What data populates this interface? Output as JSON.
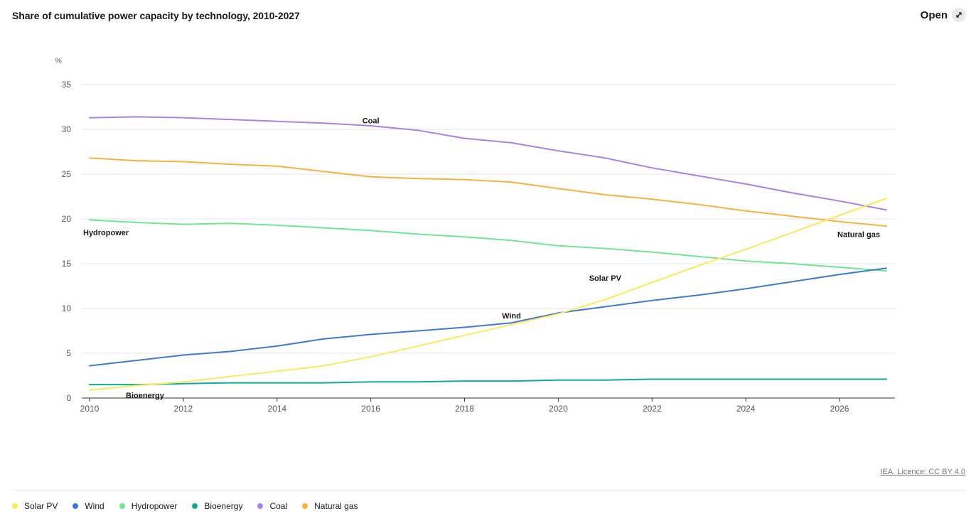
{
  "title": "Share of cumulative power capacity by technology, 2010-2027",
  "open_button": {
    "label": "Open",
    "icon": "expand-arrows-icon"
  },
  "licence": "IEA. Licence: CC BY 4.0",
  "chart_data": {
    "type": "line",
    "title": "Share of cumulative power capacity by technology, 2010-2027",
    "ylabel": "%",
    "xlabel": "",
    "x": [
      2010,
      2011,
      2012,
      2013,
      2014,
      2015,
      2016,
      2017,
      2018,
      2019,
      2020,
      2021,
      2022,
      2023,
      2024,
      2025,
      2026,
      2027
    ],
    "xticks": [
      2010,
      2012,
      2014,
      2016,
      2018,
      2020,
      2022,
      2024,
      2026
    ],
    "yticks": [
      0,
      5,
      10,
      15,
      20,
      25,
      30,
      35
    ],
    "ylim": [
      0,
      35
    ],
    "xlim": [
      2010,
      2027
    ],
    "grid": "horizontal",
    "legend_position": "bottom-left",
    "series": [
      {
        "name": "Solar PV",
        "color": "#fbe95f",
        "label_year": 2021,
        "label_value": 13.4,
        "values": [
          0.9,
          1.4,
          1.8,
          2.4,
          3.0,
          3.6,
          4.6,
          5.8,
          7.0,
          8.2,
          9.4,
          11.0,
          12.9,
          14.8,
          16.6,
          18.5,
          20.4,
          22.3
        ]
      },
      {
        "name": "Wind",
        "color": "#3e7ad3",
        "label_year": 2019,
        "label_value": 9.2,
        "values": [
          3.6,
          4.2,
          4.8,
          5.2,
          5.8,
          6.6,
          7.1,
          7.5,
          7.9,
          8.4,
          9.5,
          10.2,
          10.9,
          11.5,
          12.2,
          13.0,
          13.8,
          14.5
        ]
      },
      {
        "name": "Hydropower",
        "color": "#71e58f",
        "label_year": 2010,
        "label_value": 18.5,
        "values": [
          19.9,
          19.6,
          19.4,
          19.5,
          19.3,
          19.0,
          18.7,
          18.3,
          18.0,
          17.6,
          17.0,
          16.7,
          16.3,
          15.8,
          15.3,
          15.0,
          14.6,
          14.2
        ]
      },
      {
        "name": "Bioenergy",
        "color": "#12a896",
        "label_year": 2011,
        "label_value": 0.3,
        "values": [
          1.5,
          1.5,
          1.6,
          1.7,
          1.7,
          1.7,
          1.8,
          1.8,
          1.9,
          1.9,
          2.0,
          2.0,
          2.1,
          2.1,
          2.1,
          2.1,
          2.1,
          2.1
        ]
      },
      {
        "name": "Coal",
        "color": "#a583e8",
        "label_year": 2016,
        "label_value": 31.0,
        "values": [
          31.3,
          31.4,
          31.3,
          31.1,
          30.9,
          30.7,
          30.4,
          29.9,
          29.0,
          28.5,
          27.6,
          26.8,
          25.7,
          24.8,
          23.9,
          22.9,
          22.0,
          21.0
        ]
      },
      {
        "name": "Natural gas",
        "color": "#f8b043",
        "label_year": 2026,
        "label_value": 18.3,
        "values": [
          26.8,
          26.5,
          26.4,
          26.1,
          25.9,
          25.3,
          24.7,
          24.5,
          24.4,
          24.1,
          23.4,
          22.7,
          22.2,
          21.6,
          20.9,
          20.3,
          19.7,
          19.2
        ]
      }
    ]
  }
}
